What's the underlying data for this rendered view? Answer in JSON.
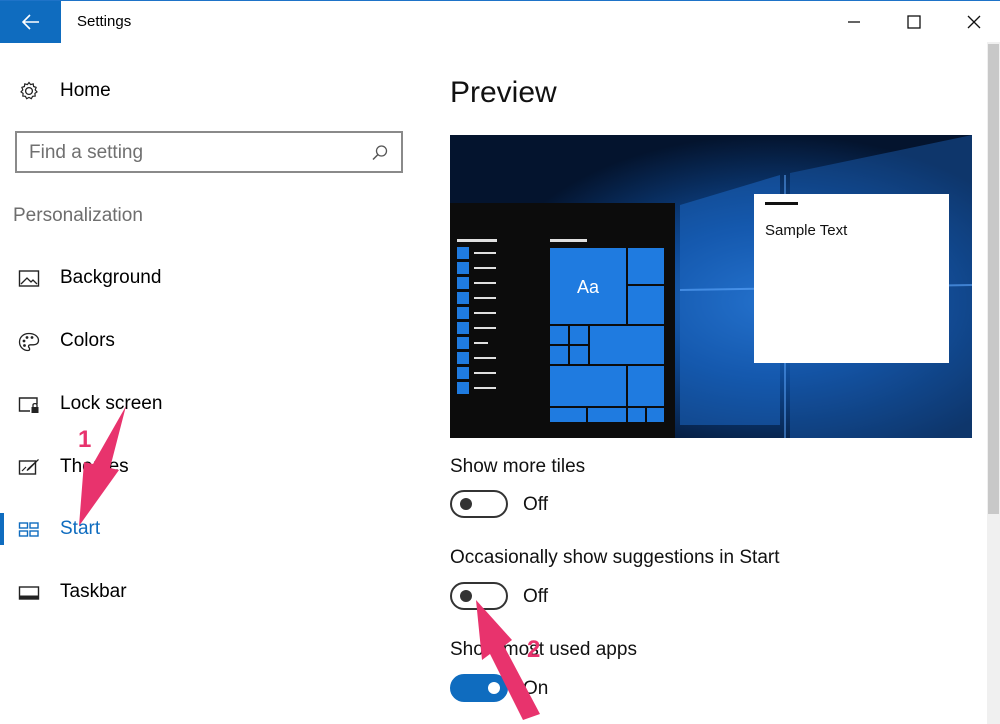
{
  "window": {
    "title": "Settings",
    "accent": "#0f6cbf"
  },
  "nav": {
    "home": "Home",
    "search_placeholder": "Find a setting",
    "section": "Personalization",
    "items": [
      {
        "label": "Background",
        "icon": "picture-icon"
      },
      {
        "label": "Colors",
        "icon": "palette-icon"
      },
      {
        "label": "Lock screen",
        "icon": "lock-screen-icon"
      },
      {
        "label": "Themes",
        "icon": "themes-icon"
      },
      {
        "label": "Start",
        "icon": "start-icon",
        "selected": true
      },
      {
        "label": "Taskbar",
        "icon": "taskbar-icon"
      }
    ]
  },
  "main": {
    "title": "Preview",
    "preview": {
      "sample_text": "Sample Text",
      "tile_text": "Aa"
    },
    "settings": [
      {
        "label": "Show more tiles",
        "state": "Off",
        "on": false
      },
      {
        "label": "Occasionally show suggestions in Start",
        "state": "Off",
        "on": false
      },
      {
        "label": "Show most used apps",
        "state": "On",
        "on": true
      }
    ]
  },
  "annotations": {
    "step1": "1",
    "step2": "2",
    "color": "#e8336d"
  }
}
